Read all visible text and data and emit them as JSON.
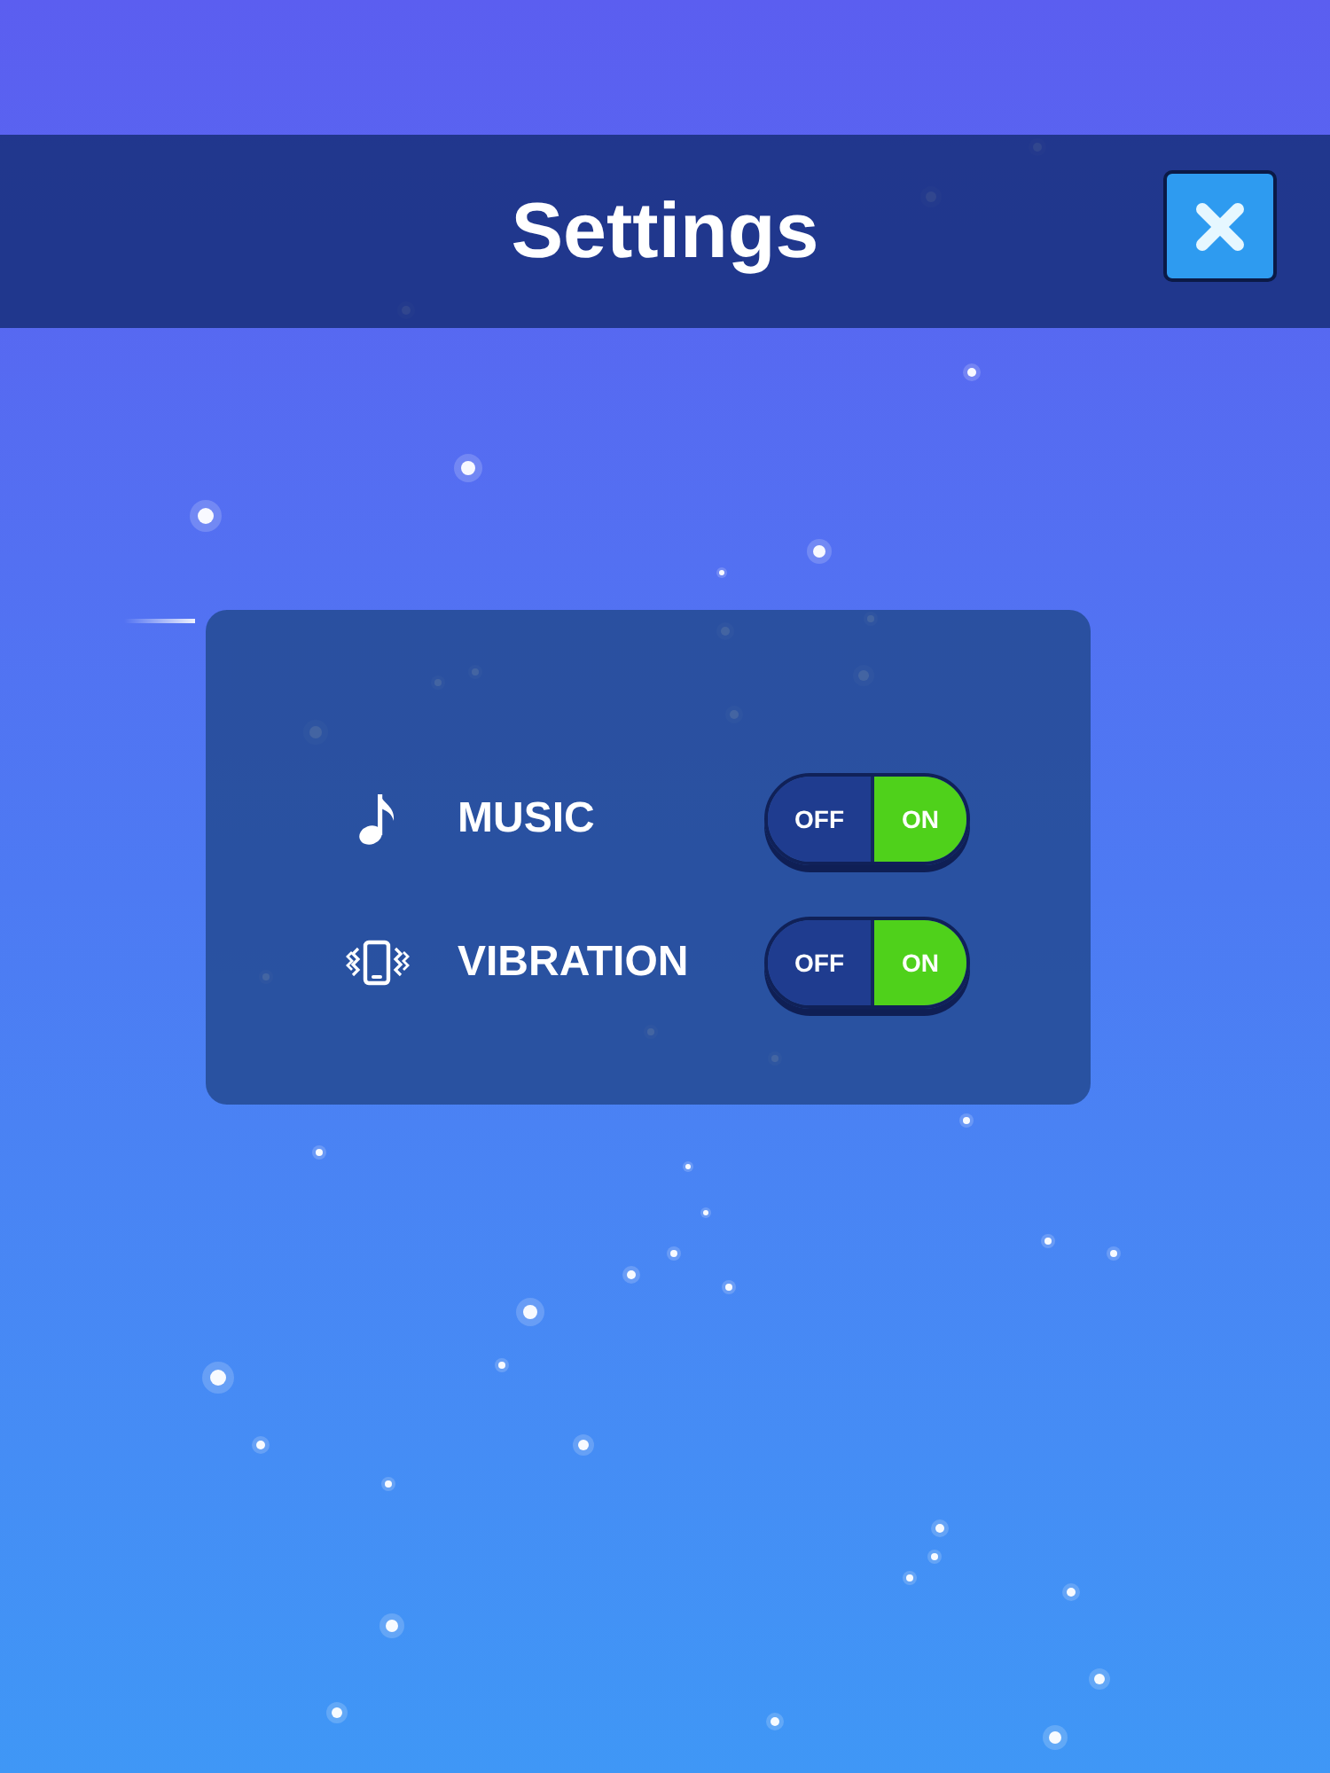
{
  "header": {
    "title": "Settings"
  },
  "settings": [
    {
      "kind": "music",
      "label": "MUSIC",
      "toggle": {
        "off_label": "OFF",
        "on_label": "ON",
        "on": true
      }
    },
    {
      "kind": "vibration",
      "label": "VIBRATION",
      "toggle": {
        "off_label": "OFF",
        "on_label": "ON",
        "on": true
      }
    }
  ]
}
